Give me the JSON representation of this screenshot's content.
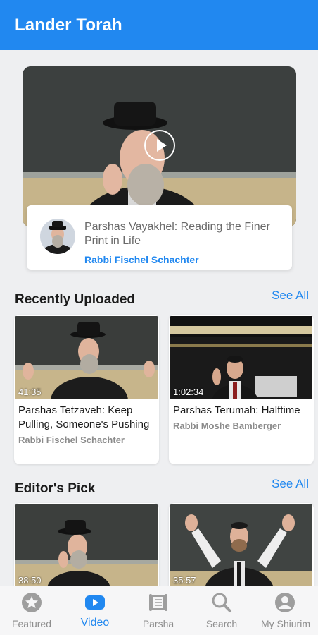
{
  "app": {
    "title": "Lander Torah"
  },
  "featured": {
    "title": "Parshas Vayakhel: Reading the Finer Print in Life",
    "author": "Rabbi Fischel Schachter"
  },
  "sections": [
    {
      "title": "Recently Uploaded",
      "see_all": "See All",
      "videos": [
        {
          "duration": "41:35",
          "title": "Parshas Tetzaveh: Keep Pulling, Someone's Pushing",
          "author": "Rabbi Fischel Schachter"
        },
        {
          "duration": "1:02:34",
          "title": "Parshas Terumah: Halftime",
          "author": "Rabbi Moshe Bamberger"
        }
      ]
    },
    {
      "title": "Editor's Pick",
      "see_all": "See All",
      "videos": [
        {
          "duration": "38:50"
        },
        {
          "duration": "35:57"
        }
      ]
    }
  ],
  "tabs": [
    {
      "label": "Featured",
      "icon": "star-icon",
      "active": false
    },
    {
      "label": "Video",
      "icon": "play-icon",
      "active": true
    },
    {
      "label": "Parsha",
      "icon": "scroll-icon",
      "active": false
    },
    {
      "label": "Search",
      "icon": "search-icon",
      "active": false
    },
    {
      "label": "My Shiurim",
      "icon": "person-icon",
      "active": false
    }
  ],
  "colors": {
    "accent": "#2188f0",
    "background": "#eeeff1"
  }
}
